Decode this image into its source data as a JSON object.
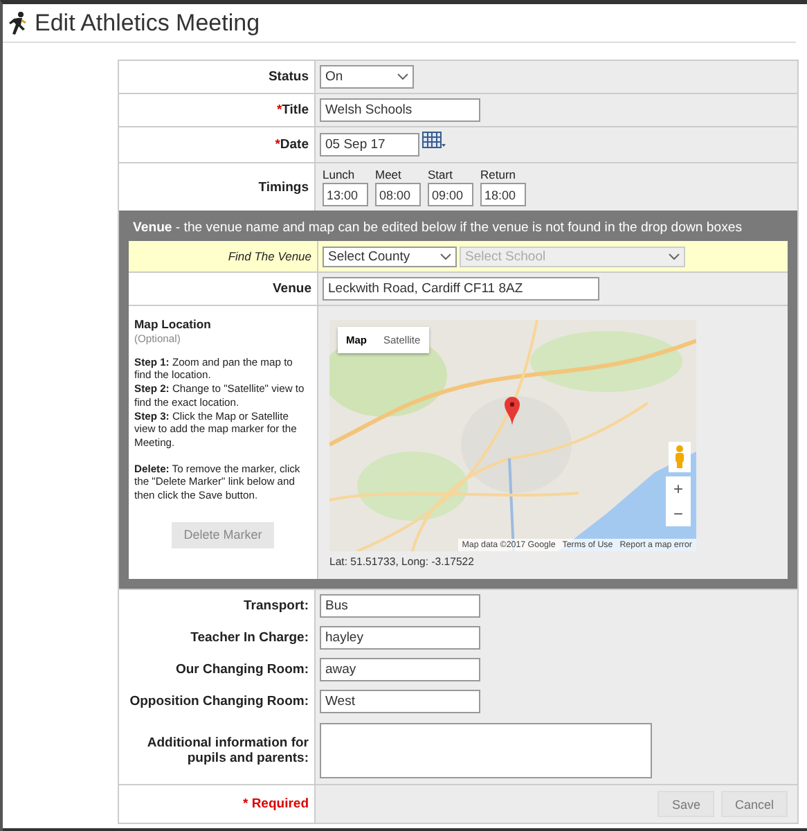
{
  "page": {
    "title": "Edit Athletics Meeting"
  },
  "top_rows": [
    {
      "kind": "select",
      "label": "Status",
      "value": "On"
    },
    {
      "kind": "text",
      "label": "Title",
      "required_mark": "*",
      "value": "Welsh Schools"
    },
    {
      "kind": "date",
      "label": "Date",
      "required_mark": "*",
      "value": "05 Sep 17"
    },
    {
      "kind": "timings",
      "label": "Timings",
      "times": [
        {
          "label": "Lunch",
          "value": "13:00"
        },
        {
          "label": "Meet",
          "value": "08:00"
        },
        {
          "label": "Start",
          "value": "09:00"
        },
        {
          "label": "Return",
          "value": "18:00"
        }
      ]
    }
  ],
  "venue": {
    "heading": "**Venue** - the venue name and map can be edited below if the venue is not found in the drop down boxes",
    "finder": {
      "label": "Find The Venue",
      "selects": [
        {
          "value": "Select County",
          "disabled": false
        },
        {
          "value": "Select School",
          "disabled": true
        }
      ]
    },
    "venue_field": {
      "label": "Venue",
      "value": "Leckwith Road, Cardiff CF11 8AZ"
    },
    "help": {
      "title": "Map Location",
      "subtitle": "(Optional)",
      "steps": [
        "**Step 1:** Zoom and pan the map to find the location.",
        "**Step 2:** Change to \"Satellite\" view to find the exact location.",
        "**Step 3:** Click the Map or Satellite view to add the map marker for the Meeting."
      ],
      "note": "**Delete:** To remove the marker, click the \"Delete Marker\" link below and then click the Save button."
    },
    "delete_button": {
      "label": "Delete Marker",
      "disabled": true
    },
    "map": {
      "kind": "picture",
      "tabs": [
        {
          "label": "Map",
          "selected": true
        },
        {
          "label": "Satellite",
          "selected": false
        }
      ],
      "zoom_in": "+",
      "zoom_out": "−",
      "attribution": [
        "Map data ©2017 Google",
        "Terms of Use",
        "Report a map error"
      ]
    },
    "coordinates": "Lat: 51.51733, Long: -3.17522"
  },
  "bottom_rows": [
    {
      "kind": "text",
      "label": "Transport:",
      "value": "Bus"
    },
    {
      "kind": "text",
      "label": "Teacher In Charge:",
      "value": "hayley"
    },
    {
      "kind": "text",
      "label": "Our Changing Room:",
      "value": "away"
    },
    {
      "kind": "text",
      "label": "Opposition Changing Room:",
      "value": "West"
    },
    {
      "kind": "textarea",
      "label": "Additional information for pupils and parents:",
      "value": ""
    }
  ],
  "footer": {
    "required_note": "* Required",
    "buttons": [
      "Save",
      "Cancel"
    ]
  }
}
